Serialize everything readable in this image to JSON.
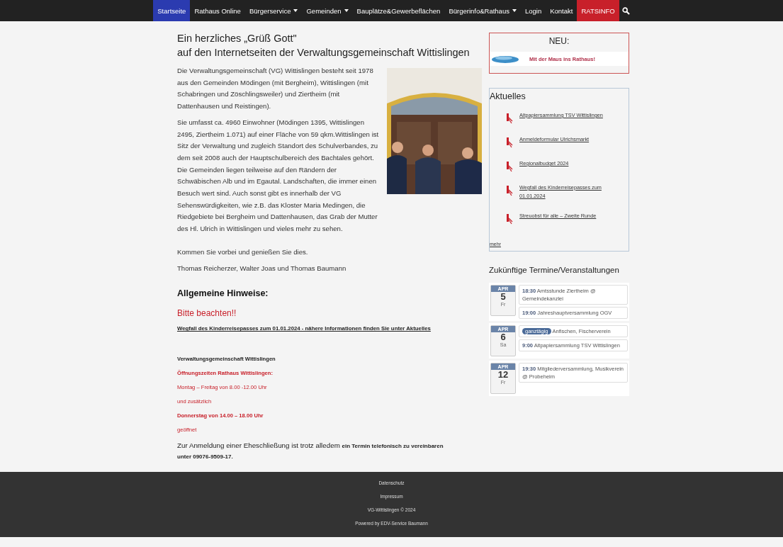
{
  "nav": {
    "items": [
      {
        "label": "Startseite",
        "selected": true,
        "kind": "link",
        "dropdown": false
      },
      {
        "label": "Rathaus Online",
        "selected": false,
        "kind": "link",
        "dropdown": false
      },
      {
        "label": "Bürgerservice",
        "selected": false,
        "kind": "link",
        "dropdown": true
      },
      {
        "label": "Gemeinden",
        "selected": false,
        "kind": "link",
        "dropdown": true
      },
      {
        "label": "Bauplätze&Gewerbeflächen",
        "selected": false,
        "kind": "link",
        "dropdown": false
      },
      {
        "label": "Bürgerinfo&Rathaus",
        "selected": false,
        "kind": "link",
        "dropdown": true
      },
      {
        "label": "Login",
        "selected": false,
        "kind": "link",
        "dropdown": false
      },
      {
        "label": "Kontakt",
        "selected": false,
        "kind": "link",
        "dropdown": false
      },
      {
        "label": "RATSINFO",
        "selected": false,
        "kind": "highlight",
        "dropdown": false
      }
    ]
  },
  "intro": {
    "title_lines": [
      "Ein herzliches „Grüß Gott\"",
      "auf den Internetseiten der Verwaltungsgemeinschaft Wittislingen"
    ],
    "paragraphs": [
      "Die Verwaltungsgemeinschaft (VG) Wittislingen besteht seit 1978 aus den Gemeinden Mödingen (mit Bergheim), Wittislingen (mit Schabringen und Zöschlingsweiler) und Ziertheim (mit Dattenhausen und Reistingen).",
      "Sie umfasst ca. 4960 Einwohner (Mödingen 1395, Wittislingen 2495, Ziertheim 1.071) auf einer Fläche von 59 qkm.Wittislingen ist Sitz der Verwaltung und zugleich Standort des Schulverbandes, zu dem seit 2008 auch der Hauptschulbereich des Bachtales gehört. Die Gemeinden liegen teilweise auf den Rändern der Schwäbischen Alb und im Egautal. Landschaften, die immer einen Besuch wert sind. Auch sonst gibt es innerhalb der VG Sehenswürdigkeiten, wie z.B. das Kloster Maria Medingen, die Riedgebiete bei Bergheim und Dattenhausen, das Grab der Mutter des Hl. Ulrich in Wittislingen und vieles mehr zu sehen.",
      "Kommen Sie vorbei und genießen Sie dies.",
      "Thomas Reicherzer, Walter Joas und Thomas Baumann"
    ]
  },
  "notices": {
    "heading": "Allgemeine Hinweise:",
    "alert": "Bitte beachten!!",
    "link": "Wegfall des Kinderreisepasses zum 01.01.2024 - nähere Informationen finden Sie unter Aktuelles",
    "lines": [
      {
        "text": "Verwaltungsgemeinschaft Wittislingen",
        "kind": "bold"
      },
      {
        "text": "Öffnungszeiten Rathaus Wittislingen:",
        "kind": "red-bold"
      },
      {
        "text": "Montag – Freitag von 8.00 -12.00 Uhr",
        "kind": "red"
      },
      {
        "text": "und zusätzlich",
        "kind": "red"
      },
      {
        "text": "Donnerstag von 14.00 – 18.00 Uhr",
        "kind": "red-bold"
      },
      {
        "text": "geöffnet",
        "kind": "red"
      }
    ],
    "note": "Zur Anmeldung einer Eheschließung ist trotz alledem **ein Termin telefonisch zu vereinbaren unter 09076-9509-17.**"
  },
  "sidebar": {
    "neu": {
      "title": "NEU:",
      "banner": "Mit der Maus ins Rathaus!"
    },
    "aktuelles": {
      "title": "Aktuelles",
      "items": [
        "Altpapiersammlung TSV Wittislingen",
        "Anmeldeformular Ulrichsmarkt",
        "Regionalbudget 2024",
        "Wegfall des Kinderreisepasses zum 01.01.2024",
        "Streuobst für alle – Zweite Runde"
      ],
      "more": "mehr"
    },
    "events": {
      "title": "Zukünftige Termine/Veranstaltungen",
      "days": [
        {
          "month": "APR",
          "day": "5",
          "weekday": "Fr",
          "entries": [
            {
              "time": "18:30",
              "text": "Amtsstunde Ziertheim @ Gemeindekanzlei"
            },
            {
              "time": "19:00",
              "text": "Jahreshauptversammlung OGV"
            }
          ]
        },
        {
          "month": "APR",
          "day": "6",
          "weekday": "Sa",
          "entries": [
            {
              "badge": "ganztägig",
              "text": "Anfischen, Fischerverein"
            },
            {
              "time": "9:00",
              "text": "Altpapiersammlung TSV Wittislingen"
            }
          ]
        },
        {
          "month": "APR",
          "day": "12",
          "weekday": "Fr",
          "entries": [
            {
              "time": "19:30",
              "text": "Mitgliederversammlung, Musikverein @ Probeheim"
            }
          ]
        }
      ]
    }
  },
  "footer": {
    "links": [
      "Datenschutz",
      "Impressum"
    ],
    "copyright": "VG-Wittislingen © 2024",
    "powered": "Powered by EDV-Service Baumann"
  }
}
